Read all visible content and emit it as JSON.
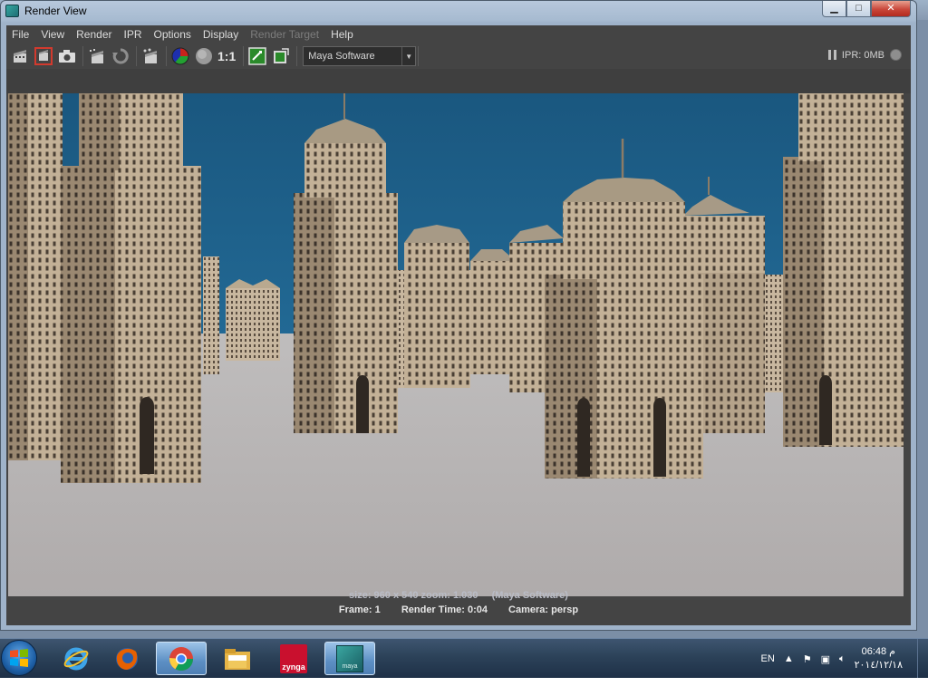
{
  "window": {
    "title": "Render View",
    "minimize": "▁",
    "maximize": "□",
    "close": "✕"
  },
  "menu": [
    "File",
    "View",
    "Render",
    "IPR",
    "Options",
    "Display",
    "Render Target",
    "Help"
  ],
  "menu_disabled": [
    "Render Target"
  ],
  "toolbar": {
    "ratio_label": "1:1",
    "renderer": "Maya Software",
    "ipr_status": "IPR: 0MB"
  },
  "render_info": {
    "size_line": "size: 960 x 540 zoom: 1.030",
    "renderer_note": "(Maya Software)",
    "frame": "Frame: 1",
    "render_time": "Render Time: 0:04",
    "camera": "Camera: persp"
  },
  "taskbar": {
    "apps": [
      "internet-explorer",
      "firefox",
      "chrome",
      "windows-explorer",
      "zynga",
      "maya"
    ],
    "zynga_label": "zynga",
    "maya_label": "maya"
  },
  "tray": {
    "language": "EN",
    "time": "م 06:48",
    "date": "٢٠١٤/١٢/١٨"
  },
  "colors": {
    "sky": "#1d5d8d",
    "ground": "#b5b1b0",
    "building": "#b8a58c",
    "panel": "#444444"
  }
}
